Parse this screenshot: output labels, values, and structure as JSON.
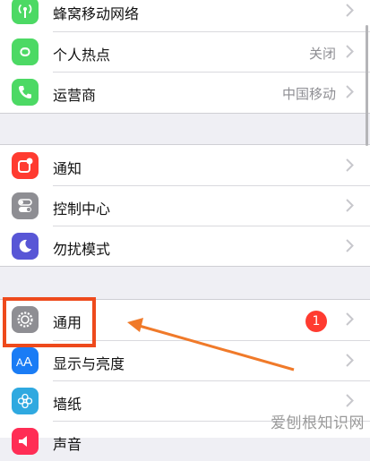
{
  "rows": [
    {
      "label": "蜂窝移动网络",
      "value": "",
      "icon": "antenna-icon",
      "color": "#4cd964"
    },
    {
      "label": "个人热点",
      "value": "关闭",
      "icon": "hotspot-link-icon",
      "color": "#4cd964"
    },
    {
      "label": "运营商",
      "value": "中国移动",
      "icon": "phone-icon",
      "color": "#4cd964"
    },
    {
      "label": "通知",
      "value": "",
      "icon": "notification-icon",
      "color": "#ff3b30"
    },
    {
      "label": "控制中心",
      "value": "",
      "icon": "toggles-icon",
      "color": "#8e8e93"
    },
    {
      "label": "勿扰模式",
      "value": "",
      "icon": "moon-icon",
      "color": "#5856d6"
    },
    {
      "label": "通用",
      "value": "",
      "badge": "1",
      "icon": "gear-icon",
      "color": "#8e8e93"
    },
    {
      "label": "显示与亮度",
      "value": "",
      "icon": "text-size-icon",
      "color": "#1a7cf5"
    },
    {
      "label": "墙纸",
      "value": "",
      "icon": "flower-icon",
      "color": "#2fa9e0"
    },
    {
      "label": "声音",
      "value": "",
      "icon": "speaker-icon",
      "color": "#ff2d55"
    }
  ],
  "annotation": {
    "highlight_color": "#ee4a1c",
    "arrow_color": "#f07a2a"
  },
  "watermark": "爱刨根知识网"
}
